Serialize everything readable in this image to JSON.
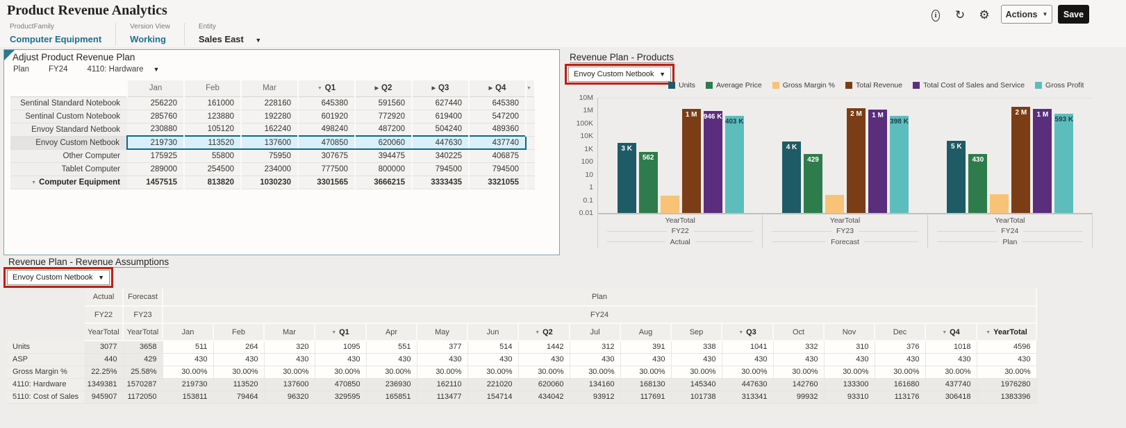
{
  "header": {
    "title": "Product Revenue Analytics",
    "actions_label": "Actions",
    "save_label": "Save",
    "icons": [
      "info-icon",
      "refresh-icon",
      "settings-icon"
    ]
  },
  "pov": {
    "fields": [
      {
        "label": "ProductFamily",
        "value": "Computer Equipment"
      },
      {
        "label": "Version View",
        "value": "Working"
      },
      {
        "label": "Entity",
        "value": "Sales East"
      }
    ]
  },
  "adjust_panel": {
    "title": "Adjust Product Revenue Plan",
    "context": {
      "scenario": "Plan",
      "year": "FY24",
      "account": "4110: Hardware"
    },
    "grid": {
      "columns": [
        {
          "label": "Jan",
          "state": "none"
        },
        {
          "label": "Feb",
          "state": "none"
        },
        {
          "label": "Mar",
          "state": "none"
        },
        {
          "label": "Q1",
          "state": "expanded"
        },
        {
          "label": "Q2",
          "state": "collapsed"
        },
        {
          "label": "Q3",
          "state": "collapsed"
        },
        {
          "label": "Q4",
          "state": "collapsed"
        },
        {
          "label": "",
          "state": "expanded"
        }
      ],
      "rows": [
        {
          "label": "Sentinal Standard Notebook",
          "values": [
            "256220",
            "161000",
            "228160",
            "645380",
            "591560",
            "627440",
            "645380"
          ]
        },
        {
          "label": "Sentinal Custom Notebook",
          "values": [
            "285760",
            "123880",
            "192280",
            "601920",
            "772920",
            "619400",
            "547200"
          ]
        },
        {
          "label": "Envoy Standard Netbook",
          "values": [
            "230880",
            "105120",
            "162240",
            "498240",
            "487200",
            "504240",
            "489360"
          ]
        },
        {
          "label": "Envoy Custom Netbook",
          "selected": true,
          "values": [
            "219730",
            "113520",
            "137600",
            "470850",
            "620060",
            "447630",
            "437740"
          ]
        },
        {
          "label": "Other Computer",
          "values": [
            "175925",
            "55800",
            "75950",
            "307675",
            "394475",
            "340225",
            "406875"
          ]
        },
        {
          "label": "Tablet Computer",
          "values": [
            "289000",
            "254500",
            "234000",
            "777500",
            "800000",
            "794500",
            "794500"
          ]
        },
        {
          "label": "Computer Equipment",
          "total": true,
          "values": [
            "1457515",
            "813820",
            "1030230",
            "3301565",
            "3666215",
            "3333435",
            "3321055"
          ]
        }
      ]
    }
  },
  "products_panel": {
    "title": "Revenue Plan - Products",
    "selector": {
      "value": "Envoy Custom Netbook",
      "highlighted": true,
      "highlight_color": "#bf1d12"
    },
    "chart_data": {
      "type": "bar",
      "y_scale": "log",
      "y_ticks": [
        "10M",
        "1M",
        "100K",
        "10K",
        "1K",
        "100",
        "10",
        "1",
        "0.1",
        "0.01"
      ],
      "y_range": [
        0.01,
        10000000
      ],
      "legend_position": "top",
      "groups": [
        {
          "period": "YearTotal",
          "year": "FY22",
          "scenario": "Actual"
        },
        {
          "period": "YearTotal",
          "year": "FY23",
          "scenario": "Forecast"
        },
        {
          "period": "YearTotal",
          "year": "FY24",
          "scenario": "Plan"
        }
      ],
      "series": [
        {
          "name": "Units",
          "color": "#1e5b66",
          "label_color": "#ffffff",
          "values": [
            3077,
            3658,
            4596
          ],
          "labels": [
            "3 K",
            "4 K",
            "5 K"
          ]
        },
        {
          "name": "Average Price",
          "color": "#2e7c4b",
          "label_color": "#ffffff",
          "values": [
            562,
            429,
            430
          ],
          "labels": [
            "562",
            "429",
            "430"
          ]
        },
        {
          "name": "Gross Margin %",
          "color": "#f8c377",
          "label_color": "#ffffff",
          "values": [
            0.22,
            0.26,
            0.3
          ],
          "labels": [
            "",
            "",
            ""
          ]
        },
        {
          "name": "Total Revenue",
          "color": "#7b3d15",
          "label_color": "#ffffff",
          "values": [
            1349381,
            1570287,
            1976280
          ],
          "labels": [
            "1 M",
            "2 M",
            "2 M"
          ]
        },
        {
          "name": "Total Cost of Sales and Service",
          "color": "#5a2d7d",
          "label_color": "#ffffff",
          "values": [
            945907,
            1172050,
            1383396
          ],
          "labels": [
            "946 K",
            "1 M",
            "1 M"
          ]
        },
        {
          "name": "Gross Profit",
          "color": "#5dbdbd",
          "label_color": "#1d4048",
          "values": [
            403474,
            398237,
            592884
          ],
          "labels": [
            "403 K",
            "398 K",
            "593 K"
          ]
        }
      ]
    }
  },
  "assumptions_panel": {
    "title": "Revenue Plan - Revenue Assumptions",
    "selector": {
      "value": "Envoy Custom Netbook",
      "highlighted": true,
      "highlight_color": "#bf1d12"
    },
    "table": {
      "scenario_groups": [
        {
          "label": "Actual",
          "span": 1
        },
        {
          "label": "Forecast",
          "span": 1
        },
        {
          "label": "Plan",
          "span": 17
        }
      ],
      "year_groups": [
        {
          "label": "FY22",
          "span": 1
        },
        {
          "label": "FY23",
          "span": 1
        },
        {
          "label": "FY24",
          "span": 17
        }
      ],
      "columns": [
        {
          "label": "YearTotal",
          "state": "none"
        },
        {
          "label": "YearTotal",
          "state": "none"
        },
        {
          "label": "Jan",
          "state": "none"
        },
        {
          "label": "Feb",
          "state": "none"
        },
        {
          "label": "Mar",
          "state": "none"
        },
        {
          "label": "Q1",
          "state": "expanded",
          "bold": true
        },
        {
          "label": "Apr",
          "state": "none"
        },
        {
          "label": "May",
          "state": "none"
        },
        {
          "label": "Jun",
          "state": "none"
        },
        {
          "label": "Q2",
          "state": "expanded",
          "bold": true
        },
        {
          "label": "Jul",
          "state": "none"
        },
        {
          "label": "Aug",
          "state": "none"
        },
        {
          "label": "Sep",
          "state": "none"
        },
        {
          "label": "Q3",
          "state": "expanded",
          "bold": true
        },
        {
          "label": "Oct",
          "state": "none"
        },
        {
          "label": "Nov",
          "state": "none"
        },
        {
          "label": "Dec",
          "state": "none"
        },
        {
          "label": "Q4",
          "state": "expanded",
          "bold": true
        },
        {
          "label": "YearTotal",
          "state": "expanded",
          "bold": true
        }
      ],
      "rows": [
        {
          "label": "Units",
          "values": [
            "3077",
            "3658",
            "511",
            "264",
            "320",
            "1095",
            "551",
            "377",
            "514",
            "1442",
            "312",
            "391",
            "338",
            "1041",
            "332",
            "310",
            "376",
            "1018",
            "4596"
          ]
        },
        {
          "label": "ASP",
          "values": [
            "440",
            "429",
            "430",
            "430",
            "430",
            "430",
            "430",
            "430",
            "430",
            "430",
            "430",
            "430",
            "430",
            "430",
            "430",
            "430",
            "430",
            "430",
            "430"
          ]
        },
        {
          "label": "Gross Margin %",
          "values": [
            "22.25%",
            "25.58%",
            "30.00%",
            "30.00%",
            "30.00%",
            "30.00%",
            "30.00%",
            "30.00%",
            "30.00%",
            "30.00%",
            "30.00%",
            "30.00%",
            "30.00%",
            "30.00%",
            "30.00%",
            "30.00%",
            "30.00%",
            "30.00%",
            "30.00%"
          ]
        },
        {
          "label": "4110: Hardware",
          "shaded": true,
          "values": [
            "1349381",
            "1570287",
            "219730",
            "113520",
            "137600",
            "470850",
            "236930",
            "162110",
            "221020",
            "620060",
            "134160",
            "168130",
            "145340",
            "447630",
            "142760",
            "133300",
            "161680",
            "437740",
            "1976280"
          ]
        },
        {
          "label": "5110: Cost of Sales",
          "shaded": true,
          "values": [
            "945907",
            "1172050",
            "153811",
            "79464",
            "96320",
            "329595",
            "165851",
            "113477",
            "154714",
            "434042",
            "93912",
            "117691",
            "101738",
            "313341",
            "99932",
            "93310",
            "113176",
            "306418",
            "1383396"
          ]
        }
      ]
    }
  }
}
